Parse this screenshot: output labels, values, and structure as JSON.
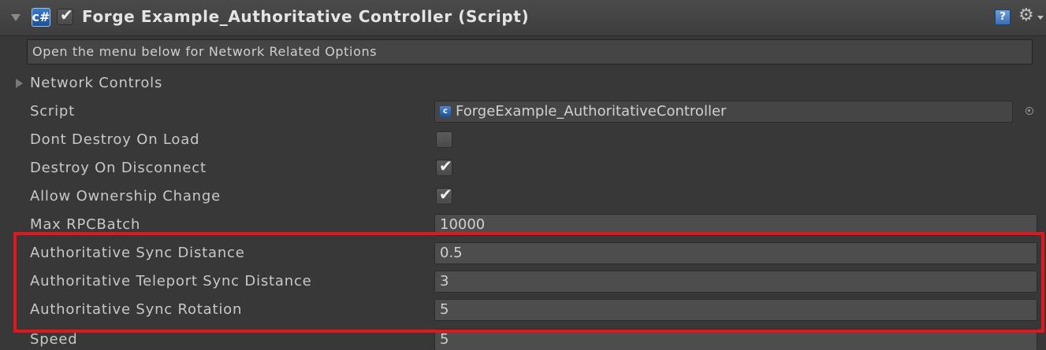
{
  "header": {
    "title": "Forge Example_Authoritative Controller (Script)",
    "badge": "c#",
    "enabled": true,
    "help_label": "?",
    "gear_glyph": "⚙"
  },
  "helpbox": {
    "text": "Open the menu below for Network Related Options"
  },
  "foldout": {
    "label": "Network Controls"
  },
  "script_field": {
    "label": "Script",
    "value": "ForgeExample_AuthoritativeController",
    "badge": "c"
  },
  "toggles": [
    {
      "label": "Dont Destroy On Load",
      "checked": false,
      "mark": ""
    },
    {
      "label": "Destroy On Disconnect",
      "checked": true,
      "mark": "✔"
    },
    {
      "label": "Allow Ownership Change",
      "checked": true,
      "mark": "✔"
    }
  ],
  "number_fields": [
    {
      "label": "Max RPCBatch",
      "value": "10000"
    },
    {
      "label": "Authoritative Sync Distance",
      "value": "0.5"
    },
    {
      "label": "Authoritative Teleport Sync Distance",
      "value": "3"
    },
    {
      "label": "Authoritative Sync Rotation",
      "value": "5"
    },
    {
      "label": "Speed",
      "value": "5"
    }
  ],
  "colors": {
    "background": "#383838",
    "highlight": "#e8141c",
    "accent": "#3d7ac8"
  }
}
